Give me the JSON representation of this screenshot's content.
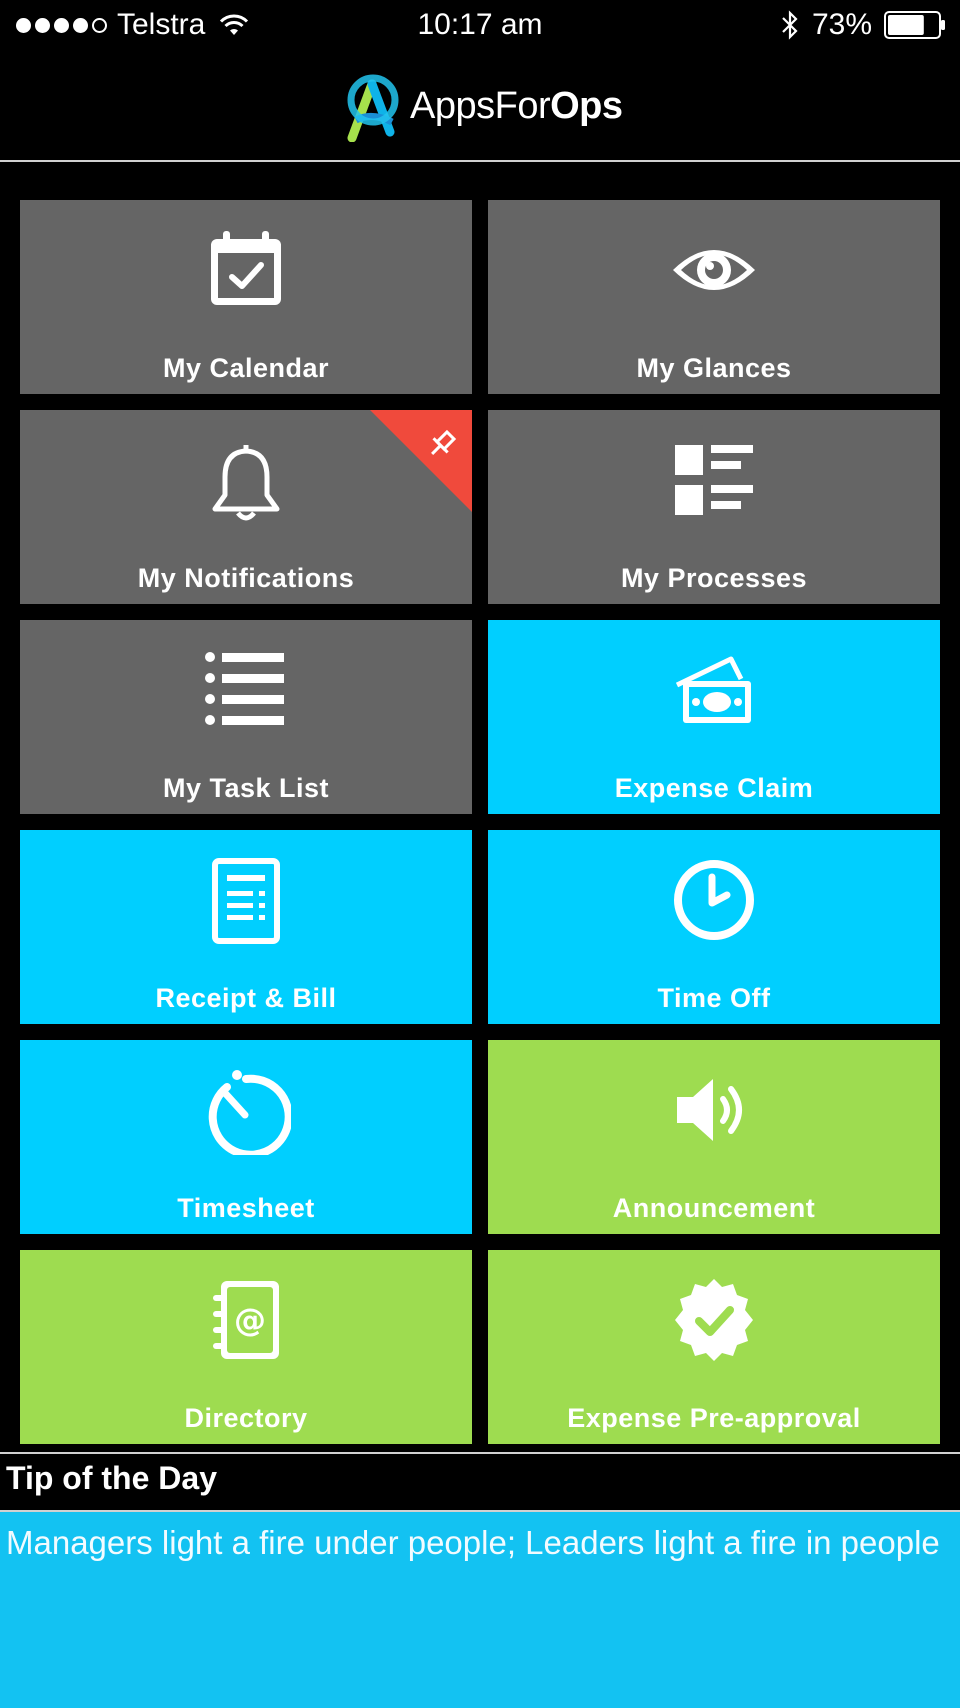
{
  "status_bar": {
    "carrier": "Telstra",
    "time": "10:17 am",
    "battery": "73%",
    "battery_level": 0.73,
    "signal_bars": 4,
    "signal_max": 5
  },
  "header": {
    "brand_part1": "Apps",
    "brand_part2": "For",
    "brand_part3": "Ops"
  },
  "tiles": [
    {
      "label": "My Calendar",
      "icon": "calendar-check-icon",
      "color": "#656565"
    },
    {
      "label": "My Glances",
      "icon": "eye-icon",
      "color": "#656565"
    },
    {
      "label": "My Notifications",
      "icon": "bell-icon",
      "color": "#656565",
      "badge_icon": "pin-icon",
      "badge_color": "#f04a3c"
    },
    {
      "label": "My Processes",
      "icon": "process-list-icon",
      "color": "#656565"
    },
    {
      "label": "My Task List",
      "icon": "bulleted-list-icon",
      "color": "#656565"
    },
    {
      "label": "Expense Claim",
      "icon": "money-icon",
      "color": "#00cfff"
    },
    {
      "label": "Receipt & Bill",
      "icon": "receipt-icon",
      "color": "#00cfff"
    },
    {
      "label": "Time Off",
      "icon": "clock-icon",
      "color": "#00cfff"
    },
    {
      "label": "Timesheet",
      "icon": "stopwatch-icon",
      "color": "#00cfff"
    },
    {
      "label": "Announcement",
      "icon": "speaker-icon",
      "color": "#9edc50"
    },
    {
      "label": "Directory",
      "icon": "address-book-icon",
      "color": "#9edc50"
    },
    {
      "label": "Expense Pre-approval",
      "icon": "verified-badge-icon",
      "color": "#9edc50"
    }
  ],
  "tip": {
    "title": "Tip of the Day",
    "text": "Managers light a fire under people; Leaders light a fire in people"
  }
}
